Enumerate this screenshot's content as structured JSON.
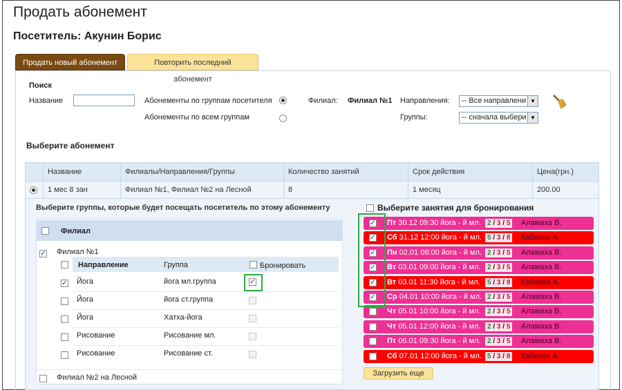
{
  "page": {
    "title": "Продать абонемент",
    "visitor_label": "Посетитель: Акунин Борис"
  },
  "tabs": {
    "sell_new": "Продать новый абонемент",
    "repeat_last": "Повторить последний абонемент"
  },
  "search": {
    "title": "Поиск",
    "name_label": "Название",
    "name_value": "",
    "by_groups_label": "Абонементы по группам посетителя",
    "all_groups_label": "Абонементы по всем группам",
    "branch_label": "Филиал:",
    "branch_value": "Филиал №1",
    "directions_label": "Направления:",
    "directions_value": "-- Все направлени",
    "groups_label": "Группы:",
    "groups_value": "-- сначала выбери"
  },
  "subscription": {
    "section_title": "Выберите абонемент",
    "columns": [
      "Название",
      "Филиалы/Направления/Группы",
      "Количество занятий",
      "Срок действия",
      "Цена(грн.)"
    ],
    "rows": [
      [
        "1 мес 8 зан",
        "Филиал №1, Филиал №2 на Лесной",
        "8",
        "1 месяц",
        "200.00"
      ]
    ]
  },
  "groups": {
    "prompt": "Выберите группы, которые будет посещать посетитель по этому абонементу",
    "branch_header": "Филиал",
    "branch1": "Филиал №1",
    "branch2": "Филиал №2 на Лесной",
    "inner_headers": {
      "direction": "Направление",
      "group": "Группа",
      "book": "Бронировать"
    },
    "rows": [
      {
        "direction": "Йога",
        "group": "йога мл.группа",
        "checked": true,
        "book": true
      },
      {
        "direction": "Йога",
        "group": "йога ст.группа",
        "checked": false,
        "book": false
      },
      {
        "direction": "Йога",
        "group": "Хатха-йога",
        "checked": false,
        "book": false
      },
      {
        "direction": "Рисование",
        "group": "Рисование мл.",
        "checked": false,
        "book": false
      },
      {
        "direction": "Рисование",
        "group": "Рисование ст.",
        "checked": false,
        "book": false
      }
    ]
  },
  "sessions": {
    "title": "Выберите занятия для бронирования",
    "load_more": "Загрузить еще",
    "items": [
      {
        "day": "Пт",
        "text": "30.12 09:30 йога - й мл.",
        "a": "2",
        "b": "3",
        "c": "5",
        "teacher": "Аламаха В.",
        "color": "#ee2f94",
        "checked": true
      },
      {
        "day": "Сб",
        "text": "31.12 12:00 йога - й мл.",
        "a": "5",
        "b": "3",
        "c": "8",
        "teacher": "Кабаева А.",
        "color": "#ff0000",
        "checked": true
      },
      {
        "day": "Пн",
        "text": "02.01 08:00 йога - й мл.",
        "a": "2",
        "b": "3",
        "c": "5",
        "teacher": "Аламаха В.",
        "color": "#ee2f94",
        "checked": true
      },
      {
        "day": "Вт",
        "text": "03.01 09:00 йога - й мл.",
        "a": "2",
        "b": "3",
        "c": "5",
        "teacher": "Аламаха В.",
        "color": "#ee2f94",
        "checked": true
      },
      {
        "day": "Вт",
        "text": "03.01 11:30 йога - й мл.",
        "a": "5",
        "b": "3",
        "c": "8",
        "teacher": "Кабаева А.",
        "color": "#ff0000",
        "checked": true
      },
      {
        "day": "Ср",
        "text": "04.01 10:00 йога - й мл.",
        "a": "2",
        "b": "3",
        "c": "5",
        "teacher": "Аламаха В.",
        "color": "#ee2f94",
        "checked": true
      },
      {
        "day": "Чт",
        "text": "05.01 10:00 йога - й мл.",
        "a": "2",
        "b": "3",
        "c": "5",
        "teacher": "Аламаха В.",
        "color": "#ee2f94",
        "checked": false
      },
      {
        "day": "Чт",
        "text": "05.01 12:00 йога - й мл.",
        "a": "2",
        "b": "3",
        "c": "5",
        "teacher": "Аламаха В.",
        "color": "#ee2f94",
        "checked": false
      },
      {
        "day": "Пт",
        "text": "06.01 09:30 йога - й мл.",
        "a": "2",
        "b": "3",
        "c": "5",
        "teacher": "Аламаха В.",
        "color": "#ee2f94",
        "checked": false
      },
      {
        "day": "Сб",
        "text": "07.01 12:00 йога - й мл.",
        "a": "5",
        "b": "3",
        "c": "8",
        "teacher": "Кабаева А.",
        "color": "#ff0000",
        "checked": false
      }
    ]
  },
  "icons": {
    "clear": "broom-icon"
  }
}
